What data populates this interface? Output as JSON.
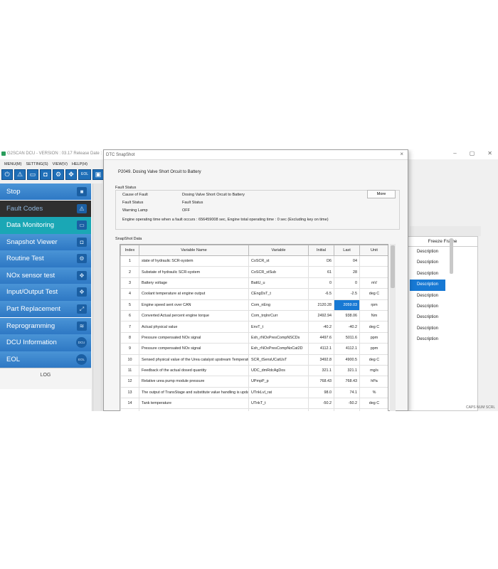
{
  "window": {
    "title": "G2SCAN DCU - VERSION : 03.17 Release Date : 0",
    "controls": [
      "–",
      "▢",
      "✕"
    ]
  },
  "menu": [
    "MENU(M)",
    "SETTING(S)",
    "VIEW(V)",
    "HELP(H)"
  ],
  "toolbar": {
    "buttons": [
      {
        "icon": "power-icon",
        "glyph": "⏻"
      },
      {
        "icon": "warning-icon",
        "glyph": "⚠"
      },
      {
        "icon": "monitor-icon",
        "glyph": "▭"
      },
      {
        "icon": "camera-icon",
        "glyph": "◘"
      },
      {
        "icon": "routine-icon",
        "glyph": "⚙"
      },
      {
        "icon": "io-icon",
        "glyph": "✥"
      },
      {
        "icon": "eol-icon",
        "glyph": "EOL"
      },
      {
        "icon": "window-icon",
        "glyph": "▣"
      }
    ]
  },
  "sidebar": {
    "items": [
      {
        "label": "Stop",
        "style": "normal",
        "icon": "■"
      },
      {
        "label": "Fault Codes",
        "style": "dark",
        "icon": "⚠"
      },
      {
        "label": "Data Monitoring",
        "style": "active",
        "icon": "▭"
      },
      {
        "label": "Snapshot Viewer",
        "style": "normal",
        "icon": "◘"
      },
      {
        "label": "Routine Test",
        "style": "normal",
        "icon": "⚙"
      },
      {
        "label": "NOx sensor test",
        "style": "normal",
        "icon": "✥"
      },
      {
        "label": "Input/Output Test",
        "style": "normal",
        "icon": "✥"
      },
      {
        "label": "Part Replacement",
        "style": "normal",
        "icon": "⤢"
      },
      {
        "label": "Reprogramming",
        "style": "normal",
        "icon": "≋"
      },
      {
        "label": "DCU Information",
        "style": "normal",
        "icon": "DCU"
      },
      {
        "label": "EOL",
        "style": "normal",
        "icon": "EOL"
      }
    ],
    "log_label": "LOG"
  },
  "freeze_frame": {
    "header": "Freeze Frame",
    "rows": [
      "Description",
      "Description",
      "Description",
      "Description",
      "Description",
      "Description",
      "Description",
      "Description",
      "Description"
    ],
    "selected_index": 3
  },
  "status_bottom": "CAPS NUM SCRL",
  "dialog": {
    "title": "DTC SnapShot",
    "close": "×",
    "fault_code": "P2049. Dosing Valve Short Orcuit to Battery",
    "fault_status_label": "Fault Status",
    "fault_rows": [
      {
        "label": "Cause of Fault",
        "value": "Dosing Valve Short Orcuit to Battery"
      },
      {
        "label": "Fault Status",
        "value": "Fault Status"
      },
      {
        "label": "Warning Lamp",
        "value": "OFF"
      }
    ],
    "more_label": "More",
    "operating_time": "Engine operating time when a fault occurs : 656459008 sec, Engine total operating time : 0 sec (Excluding key on time)",
    "snapshot_label": "SnapShot Data",
    "columns": [
      "Index",
      "Variable Name",
      "Variable",
      "Initial",
      "Last",
      "Unit"
    ],
    "rows": [
      {
        "index": "1",
        "name": "state of hydraulic SCR-system",
        "variable": "CoSCR_st",
        "initial": "D6",
        "last": "04",
        "unit": ""
      },
      {
        "index": "2",
        "name": "Substate of hydraulic SCR-system",
        "variable": "CoSCR_stSub",
        "initial": "61",
        "last": "28",
        "unit": ""
      },
      {
        "index": "3",
        "name": "Battery voltage",
        "variable": "BattU_u",
        "initial": "0",
        "last": "0",
        "unit": "mV"
      },
      {
        "index": "4",
        "name": "Coolant temperature at engine output",
        "variable": "CEngDsT_t",
        "initial": "-6.5",
        "last": "-2.5",
        "unit": "deg C"
      },
      {
        "index": "5",
        "name": "Engine speed sent over CAN",
        "variable": "Com_nEng",
        "initial": "2120.28",
        "last": "2059.03",
        "unit": "rpm"
      },
      {
        "index": "6",
        "name": "Converted Actual percent engine torque",
        "variable": "Com_trqInrCurr",
        "initial": "2492.94",
        "last": "938.06",
        "unit": "Nm"
      },
      {
        "index": "7",
        "name": "Actual physical value",
        "variable": "EnvT_t",
        "initial": "-40.2",
        "last": "-40.2",
        "unit": "deg C"
      },
      {
        "index": "8",
        "name": "Pressure compensated NOx signal",
        "variable": "Exh_rNOxPresCompNSCDs",
        "initial": "4497.6",
        "last": "5011.6",
        "unit": "ppm"
      },
      {
        "index": "9",
        "name": "Pressure compensated NOx signal",
        "variable": "Exh_rNOxPresCompNoCat2D",
        "initial": "4112.1",
        "last": "4112.1",
        "unit": "ppm"
      },
      {
        "index": "10",
        "name": "Sensed physical value of the Urea catalyst upstream Temperature",
        "variable": "SCR_tSensUCatUsT",
        "initial": "3492.8",
        "last": "4900.5",
        "unit": "deg C"
      },
      {
        "index": "11",
        "name": "Feedback of the actual dosed quantity",
        "variable": "UDC_dmRdcAgDos",
        "initial": "321.1",
        "last": "321.1",
        "unit": "mg/s"
      },
      {
        "index": "12",
        "name": "Relative urea pump module pressure",
        "variable": "UPmpP_p",
        "initial": "768.43",
        "last": "768.43",
        "unit": "hPa"
      },
      {
        "index": "13",
        "name": "The output of TransStage and substitute value handling is updated",
        "variable": "UTnkLvl_rat",
        "initial": "98.0",
        "last": "74.1",
        "unit": "%"
      },
      {
        "index": "14",
        "name": "Tank temperature",
        "variable": "UTnkT_t",
        "initial": "-50.2",
        "last": "-50.2",
        "unit": "deg C"
      },
      {
        "index": "15",
        "name": "",
        "variable": "",
        "initial": "",
        "last": "",
        "unit": ""
      }
    ],
    "highlight_cell": {
      "row": 4,
      "col": "last"
    }
  }
}
